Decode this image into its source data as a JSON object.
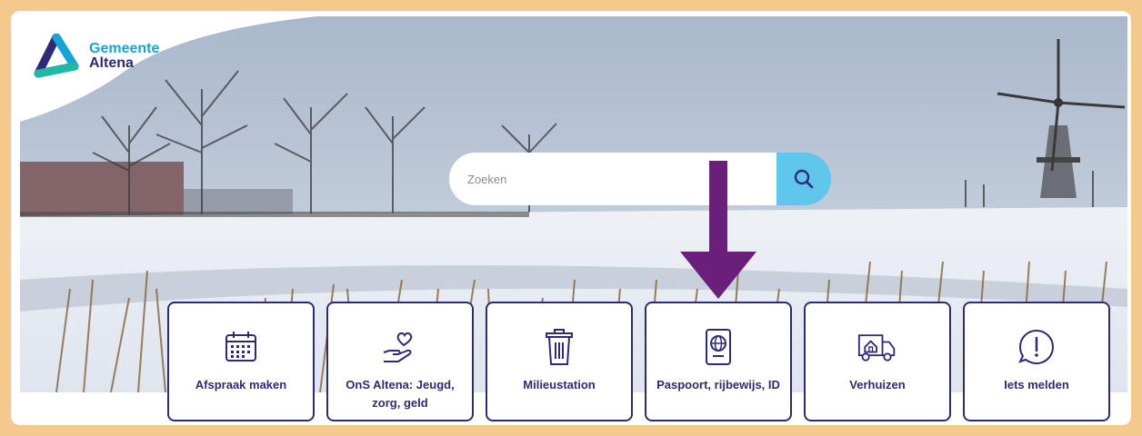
{
  "brand": {
    "line1": "Gemeente",
    "line2": "Altena",
    "colors": {
      "primary": "#2e2a7a",
      "accent": "#14a5d8",
      "search_button": "#5fc6ec",
      "arrow": "#6a1f7a",
      "frame": "#f5c98e"
    }
  },
  "search": {
    "placeholder": "Zoeken",
    "value": "",
    "button_icon": "search-icon"
  },
  "tiles": [
    {
      "label": "Afspraak maken",
      "icon": "calendar-icon"
    },
    {
      "label": "OnS Altena: Jeugd, zorg, geld",
      "icon": "heart-hand-icon"
    },
    {
      "label": "Milieustation",
      "icon": "trash-bin-icon"
    },
    {
      "label": "Paspoort, rijbewijs, ID",
      "icon": "passport-icon"
    },
    {
      "label": "Verhuizen",
      "icon": "moving-truck-icon"
    },
    {
      "label": "Iets melden",
      "icon": "alert-circle-icon"
    }
  ],
  "annotation": {
    "icon": "down-arrow-icon"
  }
}
